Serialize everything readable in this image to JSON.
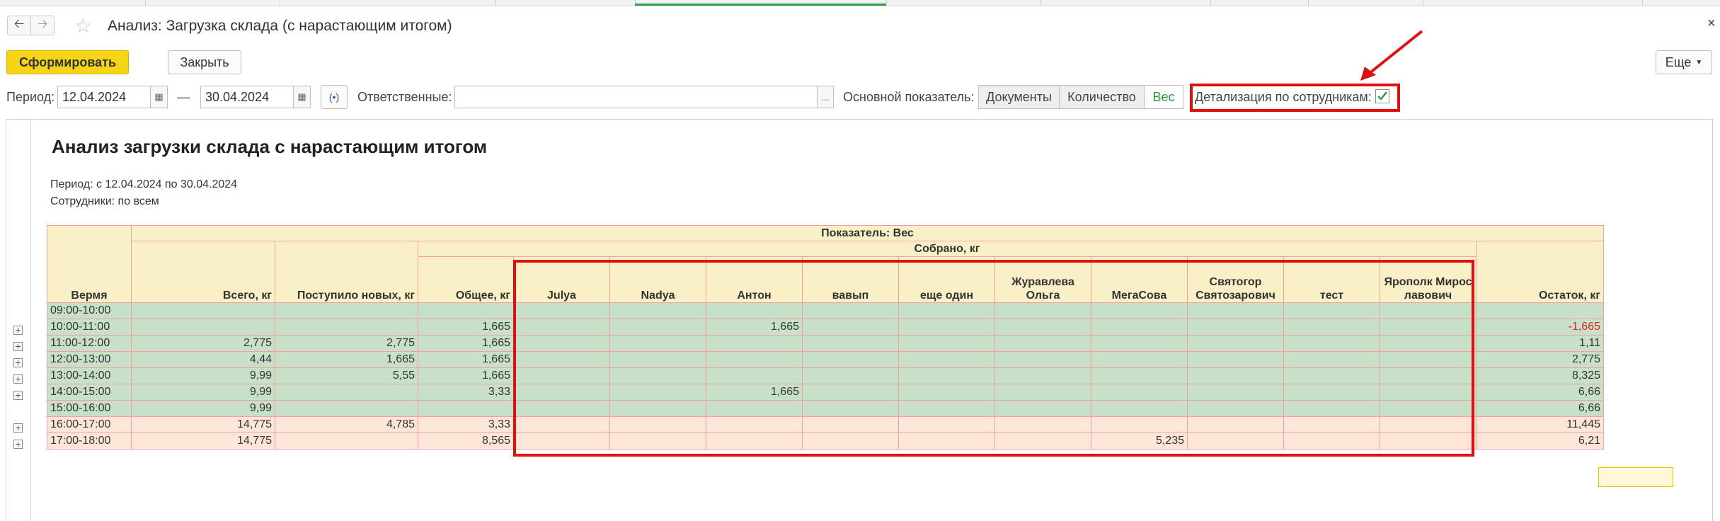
{
  "window": {
    "title": "Анализ: Загрузка склада (с нарастающим итогом)",
    "close_glyph": "×"
  },
  "icons": {
    "back": "arrow-left-icon",
    "forward": "arrow-right-icon",
    "favorite": "star-icon",
    "calendar": "calendar-icon",
    "period": "period-select-icon"
  },
  "toolbar": {
    "generate_label": "Сформировать",
    "close_label": "Закрыть",
    "more_label": "Еще"
  },
  "filters": {
    "period_label": "Период:",
    "date_from": "12.04.2024",
    "dash": "—",
    "date_to": "30.04.2024",
    "responsible_label": "Ответственные:",
    "responsible_value": "",
    "ellipsis": "...",
    "indicator_label": "Основной показатель:",
    "indicator_options": [
      "Документы",
      "Количество",
      "Вес"
    ],
    "indicator_selected": "Вес",
    "detail_label": "Детализация по сотрудникам:",
    "detail_checked": true
  },
  "colors": {
    "accent": "#f5d416",
    "highlight": "#e01010",
    "selected_option": "#2a9a3c",
    "negative": "#e02020"
  },
  "report": {
    "title": "Анализ загрузки склада с нарастающим итогом",
    "period_line": "Период: с 12.04.2024 по 30.04.2024",
    "employees_line": "Сотрудники: по всем",
    "indicator_header": "Показатель: Вес",
    "collected_header": "Собрано, кг",
    "columns": {
      "time": "Вермя",
      "total": "Всего, кг",
      "new": "Поступило новых, кг",
      "overall": "Общее, кг",
      "remainder": "Остаток, кг"
    },
    "employees": [
      "Julya",
      "Nadya",
      "Антон",
      "вавып",
      "еще один",
      "Журавлева Ольга",
      "МегаСова",
      "Святогор Святозарович",
      "тест",
      "Ярополк Мирославович"
    ],
    "rows": [
      {
        "time": "09:00-10:00",
        "total": "",
        "new": "",
        "overall": "",
        "emp": [
          "",
          "",
          "",
          "",
          "",
          "",
          "",
          "",
          "",
          ""
        ],
        "rest": "",
        "style": "g",
        "expand": false
      },
      {
        "time": "10:00-11:00",
        "total": "",
        "new": "",
        "overall": "1,665",
        "emp": [
          "",
          "",
          "1,665",
          "",
          "",
          "",
          "",
          "",
          "",
          ""
        ],
        "rest": "-1,665",
        "style": "g",
        "expand": true
      },
      {
        "time": "11:00-12:00",
        "total": "2,775",
        "new": "2,775",
        "overall": "1,665",
        "emp": [
          "",
          "",
          "",
          "",
          "",
          "",
          "",
          "",
          "",
          ""
        ],
        "rest": "1,11",
        "style": "g",
        "expand": true
      },
      {
        "time": "12:00-13:00",
        "total": "4,44",
        "new": "1,665",
        "overall": "1,665",
        "emp": [
          "",
          "",
          "",
          "",
          "",
          "",
          "",
          "",
          "",
          ""
        ],
        "rest": "2,775",
        "style": "g",
        "expand": true
      },
      {
        "time": "13:00-14:00",
        "total": "9,99",
        "new": "5,55",
        "overall": "1,665",
        "emp": [
          "",
          "",
          "",
          "",
          "",
          "",
          "",
          "",
          "",
          ""
        ],
        "rest": "8,325",
        "style": "g",
        "expand": true
      },
      {
        "time": "14:00-15:00",
        "total": "9,99",
        "new": "",
        "overall": "3,33",
        "emp": [
          "",
          "",
          "1,665",
          "",
          "",
          "",
          "",
          "",
          "",
          ""
        ],
        "rest": "6,66",
        "style": "g",
        "expand": true
      },
      {
        "time": "15:00-16:00",
        "total": "9,99",
        "new": "",
        "overall": "",
        "emp": [
          "",
          "",
          "",
          "",
          "",
          "",
          "",
          "",
          "",
          ""
        ],
        "rest": "6,66",
        "style": "g",
        "expand": false
      },
      {
        "time": "16:00-17:00",
        "total": "14,775",
        "new": "4,785",
        "overall": "3,33",
        "emp": [
          "",
          "",
          "",
          "",
          "",
          "",
          "",
          "",
          "",
          ""
        ],
        "rest": "11,445",
        "style": "p",
        "expand": true
      },
      {
        "time": "17:00-18:00",
        "total": "14,775",
        "new": "",
        "overall": "8,565",
        "emp": [
          "",
          "",
          "",
          "",
          "",
          "",
          "5,235",
          "",
          "",
          ""
        ],
        "rest": "6,21",
        "style": "p",
        "expand": true
      }
    ]
  }
}
